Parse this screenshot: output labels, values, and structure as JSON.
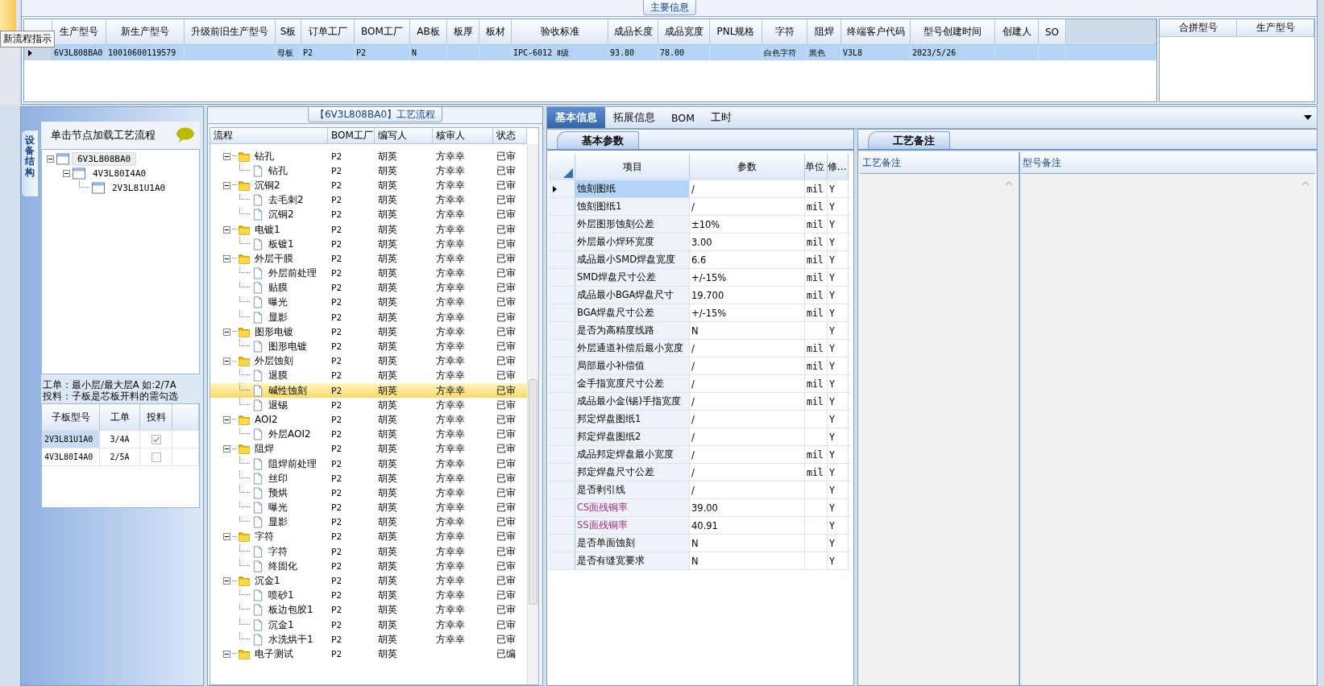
{
  "top_panel": {
    "title": "主要信息",
    "tooltip": "新流程指示",
    "grid": {
      "columns": [
        "生产型号",
        "新生产型号",
        "升级前旧生产型号",
        "S板",
        "订单工厂",
        "BOM工厂",
        "AB板",
        "板厚",
        "板材",
        "验收标准",
        "成品长度",
        "成品宽度",
        "PNL规格",
        "字符",
        "阻焊",
        "终端客户代码",
        "型号创建时间",
        "创建人",
        "SO"
      ],
      "rows": [
        {
          "selected": true,
          "cells": [
            "6V3L808BA0",
            "10010600119579",
            null,
            "母板",
            "P2",
            "P2",
            "N",
            null,
            null,
            "IPC-6012 Ⅱ级",
            "93.80",
            "78.00",
            null,
            "白色字符",
            "黑色",
            "V3L8",
            "2023/5/26",
            null,
            null
          ]
        }
      ]
    },
    "merge_grid": {
      "columns": [
        "合拼型号",
        "生产型号"
      ]
    }
  },
  "structure_panel": {
    "side_tab": "设备结构",
    "header": "单击节点加载工艺流程",
    "tree": [
      {
        "label": "6V3L808BA0",
        "expanded": true,
        "selected": true,
        "children": [
          {
            "label": "4V3L80I4A0",
            "expanded": true,
            "selected": false,
            "children": [
              {
                "label": "2V3L81U1A0",
                "selected": false
              }
            ]
          }
        ]
      }
    ],
    "notes": [
      "工单：最小层/最大层A 如:2/7A",
      "投料：子板是芯板开料的需勾选"
    ],
    "sub_table": {
      "columns": [
        "子板型号",
        "工单",
        "投料"
      ],
      "rows": [
        {
          "model": "2V3L81U1A0",
          "order": "3/4A",
          "checked": true,
          "selected": true
        },
        {
          "model": "4V3L80I4A0",
          "order": "2/5A",
          "checked": false,
          "selected": false
        }
      ]
    }
  },
  "process_panel": {
    "title": "【6V3L808BA0】工艺流程",
    "columns": [
      "流程",
      "BOM工厂",
      "编写人",
      "核审人",
      "状态"
    ],
    "steps": [
      {
        "name": "钻孔",
        "factory": "P2",
        "writer": "胡英",
        "reviewer": "方幸幸",
        "status": "已审",
        "expanded": true,
        "selected": false,
        "children": [
          {
            "name": "钻孔",
            "factory": "P2",
            "writer": "胡英",
            "reviewer": "方幸幸",
            "status": "已审",
            "selected": false
          }
        ]
      },
      {
        "name": "沉铜2",
        "factory": "P2",
        "writer": "胡英",
        "reviewer": "方幸幸",
        "status": "已审",
        "expanded": true,
        "selected": false,
        "children": [
          {
            "name": "去毛刺2",
            "factory": "P2",
            "writer": "胡英",
            "reviewer": "方幸幸",
            "status": "已审",
            "selected": false
          },
          {
            "name": "沉铜2",
            "factory": "P2",
            "writer": "胡英",
            "reviewer": "方幸幸",
            "status": "已审",
            "selected": false
          }
        ]
      },
      {
        "name": "电镀1",
        "factory": "P2",
        "writer": "胡英",
        "reviewer": "方幸幸",
        "status": "已审",
        "expanded": true,
        "selected": false,
        "children": [
          {
            "name": "板镀1",
            "factory": "P2",
            "writer": "胡英",
            "reviewer": "方幸幸",
            "status": "已审",
            "selected": false
          }
        ]
      },
      {
        "name": "外层干膜",
        "factory": "P2",
        "writer": "胡英",
        "reviewer": "方幸幸",
        "status": "已审",
        "expanded": true,
        "selected": false,
        "children": [
          {
            "name": "外层前处理",
            "factory": "P2",
            "writer": "胡英",
            "reviewer": "方幸幸",
            "status": "已审",
            "selected": false
          },
          {
            "name": "贴膜",
            "factory": "P2",
            "writer": "胡英",
            "reviewer": "方幸幸",
            "status": "已审",
            "selected": false
          },
          {
            "name": "曝光",
            "factory": "P2",
            "writer": "胡英",
            "reviewer": "方幸幸",
            "status": "已审",
            "selected": false
          },
          {
            "name": "显影",
            "factory": "P2",
            "writer": "胡英",
            "reviewer": "方幸幸",
            "status": "已审",
            "selected": false
          }
        ]
      },
      {
        "name": "图形电镀",
        "factory": "P2",
        "writer": "胡英",
        "reviewer": "方幸幸",
        "status": "已审",
        "expanded": true,
        "selected": false,
        "children": [
          {
            "name": "图形电镀",
            "factory": "P2",
            "writer": "胡英",
            "reviewer": "方幸幸",
            "status": "已审",
            "selected": false
          }
        ]
      },
      {
        "name": "外层蚀刻",
        "factory": "P2",
        "writer": "胡英",
        "reviewer": "方幸幸",
        "status": "已审",
        "expanded": true,
        "selected": false,
        "children": [
          {
            "name": "退膜",
            "factory": "P2",
            "writer": "胡英",
            "reviewer": "方幸幸",
            "status": "已审",
            "selected": false
          },
          {
            "name": "碱性蚀刻",
            "factory": "P2",
            "writer": "胡英",
            "reviewer": "方幸幸",
            "status": "已审",
            "selected": true
          },
          {
            "name": "退锡",
            "factory": "P2",
            "writer": "胡英",
            "reviewer": "方幸幸",
            "status": "已审",
            "selected": false
          }
        ]
      },
      {
        "name": "AOI2",
        "factory": "P2",
        "writer": "胡英",
        "reviewer": "方幸幸",
        "status": "已审",
        "expanded": true,
        "selected": false,
        "children": [
          {
            "name": "外层AOI2",
            "factory": "P2",
            "writer": "胡英",
            "reviewer": "方幸幸",
            "status": "已审",
            "selected": false
          }
        ]
      },
      {
        "name": "阻焊",
        "factory": "P2",
        "writer": "胡英",
        "reviewer": "方幸幸",
        "status": "已审",
        "expanded": true,
        "selected": false,
        "children": [
          {
            "name": "阻焊前处理",
            "factory": "P2",
            "writer": "胡英",
            "reviewer": "方幸幸",
            "status": "已审",
            "selected": false
          },
          {
            "name": "丝印",
            "factory": "P2",
            "writer": "胡英",
            "reviewer": "方幸幸",
            "status": "已审",
            "selected": false
          },
          {
            "name": "预烘",
            "factory": "P2",
            "writer": "胡英",
            "reviewer": "方幸幸",
            "status": "已审",
            "selected": false
          },
          {
            "name": "曝光",
            "factory": "P2",
            "writer": "胡英",
            "reviewer": "方幸幸",
            "status": "已审",
            "selected": false
          },
          {
            "name": "显影",
            "factory": "P2",
            "writer": "胡英",
            "reviewer": "方幸幸",
            "status": "已审",
            "selected": false
          }
        ]
      },
      {
        "name": "字符",
        "factory": "P2",
        "writer": "胡英",
        "reviewer": "方幸幸",
        "status": "已审",
        "expanded": true,
        "selected": false,
        "children": [
          {
            "name": "字符",
            "factory": "P2",
            "writer": "胡英",
            "reviewer": "方幸幸",
            "status": "已审",
            "selected": false
          },
          {
            "name": "终固化",
            "factory": "P2",
            "writer": "胡英",
            "reviewer": "方幸幸",
            "status": "已审",
            "selected": false
          }
        ]
      },
      {
        "name": "沉金1",
        "factory": "P2",
        "writer": "胡英",
        "reviewer": "方幸幸",
        "status": "已审",
        "expanded": true,
        "selected": false,
        "children": [
          {
            "name": "喷砂1",
            "factory": "P2",
            "writer": "胡英",
            "reviewer": "方幸幸",
            "status": "已审",
            "selected": false
          },
          {
            "name": "板边包胶1",
            "factory": "P2",
            "writer": "胡英",
            "reviewer": "方幸幸",
            "status": "已审",
            "selected": false
          },
          {
            "name": "沉金1",
            "factory": "P2",
            "writer": "胡英",
            "reviewer": "方幸幸",
            "status": "已审",
            "selected": false
          },
          {
            "name": "水洗烘干1",
            "factory": "P2",
            "writer": "胡英",
            "reviewer": "方幸幸",
            "status": "已审",
            "selected": false
          }
        ]
      },
      {
        "name": "电子测试",
        "factory": "P2",
        "writer": "胡英",
        "status": "已编",
        "expanded": true,
        "selected": false
      }
    ]
  },
  "detail_panel": {
    "tabs": [
      {
        "label": "基本信息",
        "selected": true
      },
      {
        "label": "拓展信息",
        "selected": false
      },
      {
        "label": "BOM",
        "selected": false
      },
      {
        "label": "工时",
        "selected": false
      }
    ],
    "params_tab": "基本参数",
    "params": {
      "columns": [
        "项目",
        "参数",
        "单位",
        "修..."
      ],
      "rows": [
        {
          "item": "蚀刻图纸",
          "value": "/",
          "unit": "mil",
          "flag": "Y",
          "selected": true
        },
        {
          "item": "蚀刻图纸1",
          "value": "/",
          "unit": "mil",
          "flag": "Y",
          "selected": false
        },
        {
          "item": "外层图形蚀刻公差",
          "value": "±10%",
          "unit": "mil",
          "flag": "Y",
          "selected": false
        },
        {
          "item": "外层最小焊环宽度",
          "value": "3.00",
          "unit": "mil",
          "flag": "Y",
          "selected": false
        },
        {
          "item": "成品最小SMD焊盘宽度",
          "value": "6.6",
          "unit": "mil",
          "flag": "Y",
          "selected": false
        },
        {
          "item": "SMD焊盘尺寸公差",
          "value": "+/-15%",
          "unit": "mil",
          "flag": "Y",
          "selected": false
        },
        {
          "item": "成品最小BGA焊盘尺寸",
          "value": "19.700",
          "unit": "mil",
          "flag": "Y",
          "selected": false
        },
        {
          "item": "BGA焊盘尺寸公差",
          "value": "+/-15%",
          "unit": "mil",
          "flag": "Y",
          "selected": false
        },
        {
          "item": "是否为高精度线路",
          "value": "N",
          "flag": "Y",
          "selected": false
        },
        {
          "item": "外层通道补偿后最小宽度",
          "value": "/",
          "unit": "mil",
          "flag": "Y",
          "selected": false
        },
        {
          "item": "局部最小补偿值",
          "value": "/",
          "unit": "mil",
          "flag": "Y",
          "selected": false
        },
        {
          "item": "金手指宽度尺寸公差",
          "value": "/",
          "unit": "mil",
          "flag": "Y",
          "selected": false
        },
        {
          "item": "成品最小金(锡)手指宽度",
          "value": "/",
          "unit": "mil",
          "flag": "Y",
          "selected": false
        },
        {
          "item": "邦定焊盘图纸1",
          "value": "/",
          "flag": "Y",
          "selected": false
        },
        {
          "item": "邦定焊盘图纸2",
          "value": "/",
          "flag": "Y",
          "selected": false
        },
        {
          "item": "成品邦定焊盘最小宽度",
          "value": "/",
          "unit": "mil",
          "flag": "Y",
          "selected": false
        },
        {
          "item": "邦定焊盘尺寸公差",
          "value": "/",
          "unit": "mil",
          "flag": "Y",
          "selected": false
        },
        {
          "item": "是否剥引线",
          "value": "/",
          "flag": "Y",
          "selected": false
        },
        {
          "item": "CS面残铜率",
          "value": "39.00",
          "flag": "Y",
          "selected": false,
          "color": "#a0307e"
        },
        {
          "item": "SS面残铜率",
          "value": "40.91",
          "flag": "Y",
          "selected": false,
          "color": "#a0307e"
        },
        {
          "item": "是否单面蚀刻",
          "value": "N",
          "flag": "Y",
          "selected": false
        },
        {
          "item": "是否有缝宽要求",
          "value": "N",
          "flag": "Y",
          "selected": false
        }
      ]
    }
  },
  "remarks_panel": {
    "tab": "工艺备注",
    "columns": [
      "工艺备注",
      "型号备注"
    ]
  }
}
